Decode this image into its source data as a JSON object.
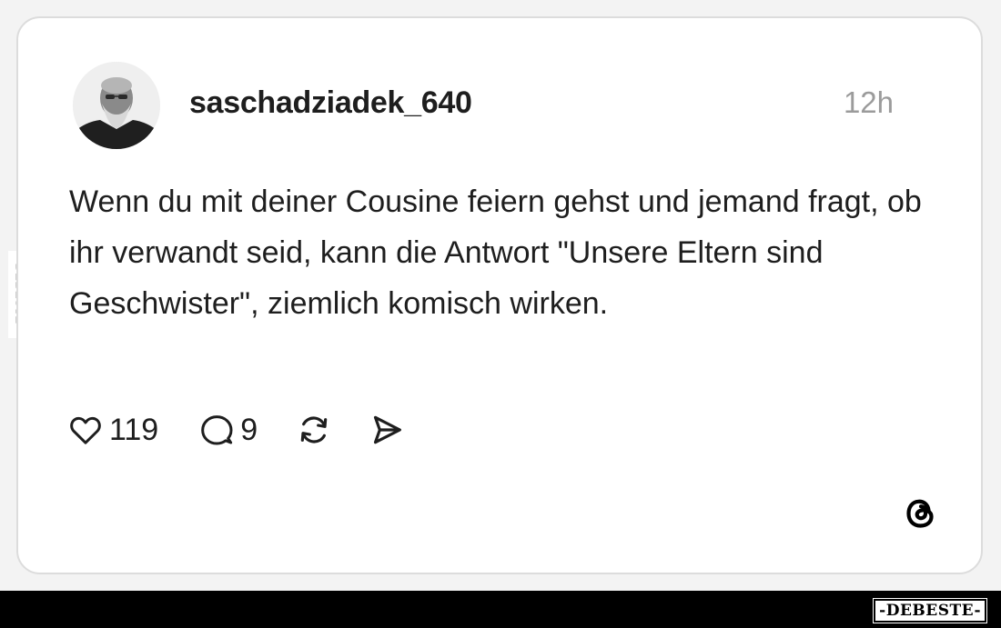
{
  "post": {
    "username": "saschadziadek_640",
    "timestamp": "12h",
    "text": "Wenn du mit deiner Cousine feiern gehst und jemand fragt, ob ihr verwandt seid, kann die Antwort \"Unsere Eltern sind Geschwister\", ziemlich komisch wirken."
  },
  "actions": {
    "like_count": "119",
    "reply_count": "9"
  },
  "icons": {
    "like": "heart-icon",
    "reply": "speech-bubble-icon",
    "repost": "repost-icon",
    "share": "send-icon",
    "platform": "threads-logo-icon"
  },
  "watermark": {
    "side": "DEBESTE",
    "bottom": "-DEBESTE-"
  },
  "colors": {
    "text": "#1e1e1e",
    "muted": "#9b9b9b",
    "card_border": "#dcdcdc",
    "bottom_bar": "#000000"
  }
}
